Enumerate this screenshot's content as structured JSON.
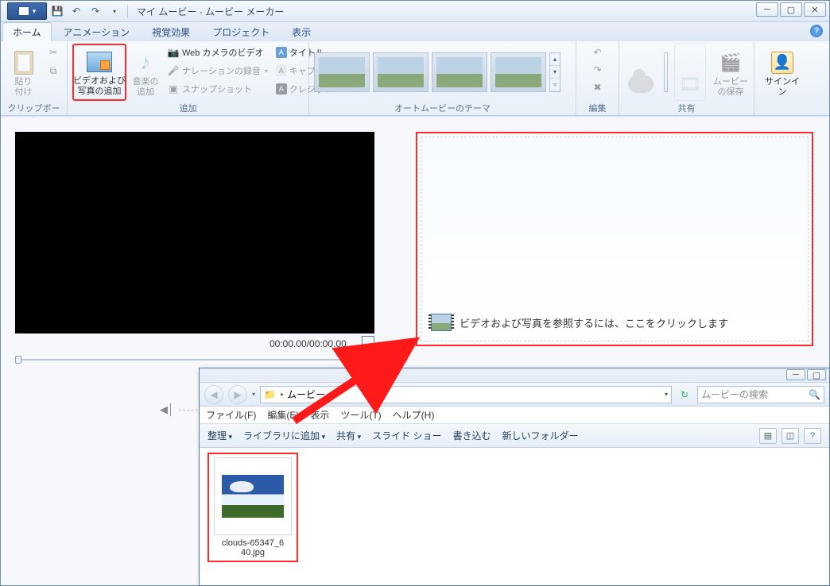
{
  "mm": {
    "title": "マイ ムービー - ムービー メーカー",
    "tabs": {
      "home": "ホーム",
      "animation": "アニメーション",
      "visual": "視覚効果",
      "project": "プロジェクト",
      "view": "表示"
    },
    "groups": {
      "clipboard": "クリップボード",
      "add": "追加",
      "automovie": "オートムービーのテーマ",
      "edit": "編集",
      "share": "共有"
    },
    "btn": {
      "paste": "貼り\n付け",
      "add_media": "ビデオおよび\n写真の追加",
      "add_music": "音楽の\n追加",
      "webcam": "Web カメラのビデオ",
      "narration": "ナレーションの録音",
      "snapshot": "スナップショット",
      "title": "タイトル",
      "caption": "キャプション",
      "credit": "クレジット",
      "save_movie": "ムービー\nの保存",
      "signin": "サインイン"
    },
    "time": "00:00.00/00:00.00",
    "drop_hint": "ビデオおよび写真を参照するには、ここをクリックします"
  },
  "ex": {
    "path": "ムービー",
    "search_placeholder": "ムービーの検索",
    "menu": {
      "file": "ファイル(F)",
      "edit": "編集(E)",
      "view": "表示",
      "tool": "ツール(T)",
      "help": "ヘルプ(H)"
    },
    "toolbar": {
      "organize": "整理",
      "add_to_lib": "ライブラリに追加",
      "share": "共有",
      "slideshow": "スライド ショー",
      "burn": "書き込む",
      "newfolder": "新しいフォルダー"
    },
    "file": {
      "name": "clouds-65347_6\n40.jpg"
    }
  }
}
